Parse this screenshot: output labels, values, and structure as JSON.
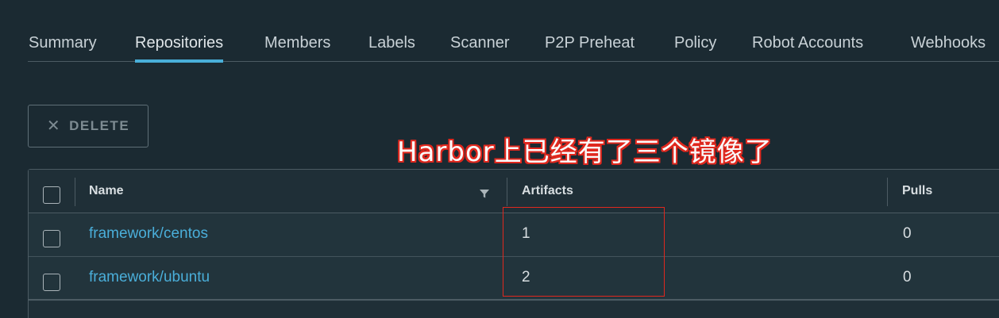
{
  "tabs": [
    {
      "label": "Summary",
      "active": false
    },
    {
      "label": "Repositories",
      "active": true
    },
    {
      "label": "Members",
      "active": false
    },
    {
      "label": "Labels",
      "active": false
    },
    {
      "label": "Scanner",
      "active": false
    },
    {
      "label": "P2P Preheat",
      "active": false
    },
    {
      "label": "Policy",
      "active": false
    },
    {
      "label": "Robot Accounts",
      "active": false
    },
    {
      "label": "Webhooks",
      "active": false
    }
  ],
  "toolbar": {
    "delete_label": "DELETE",
    "delete_icon": "close-icon"
  },
  "annotation": {
    "text": "Harbor上已经有了三个镜像了",
    "color": "#e0281e"
  },
  "grid": {
    "columns": {
      "name": "Name",
      "artifacts": "Artifacts",
      "pulls": "Pulls"
    },
    "filter_icon": "filter-icon",
    "rows": [
      {
        "name": "framework/centos",
        "artifacts": "1",
        "pulls": "0"
      },
      {
        "name": "framework/ubuntu",
        "artifacts": "2",
        "pulls": "0"
      }
    ]
  },
  "colors": {
    "background": "#1b2a32",
    "accent": "#49afd9",
    "link": "#4aaed9"
  }
}
